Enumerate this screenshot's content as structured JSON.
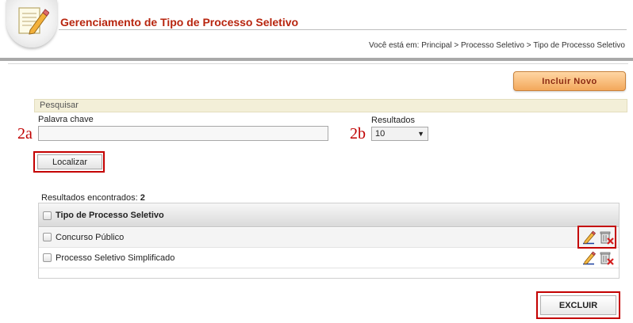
{
  "header": {
    "title": "Gerenciamento de Tipo de Processo Seletivo",
    "breadcrumb": "Você está em: Principal > Processo Seletivo > Tipo de Processo Seletivo"
  },
  "actions": {
    "include_new_label": "Incluir Novo",
    "delete_label": "EXCLUIR"
  },
  "search": {
    "section_title": "Pesquisar",
    "keyword_label": "Palavra chave",
    "keyword_value": "",
    "results_label": "Resultados",
    "results_selected": "10",
    "search_button_label": "Localizar",
    "marker_keyword": "2a",
    "marker_results": "2b"
  },
  "results": {
    "count_label": "Resultados encontrados:",
    "count_value": "2",
    "column_header": "Tipo de Processo Seletivo",
    "rows": [
      {
        "name": "Concurso Público"
      },
      {
        "name": "Processo Seletivo Simplificado"
      }
    ]
  },
  "colors": {
    "title_red": "#b8260f",
    "highlight_red": "#c40000",
    "include_button": "#f3a85b"
  }
}
